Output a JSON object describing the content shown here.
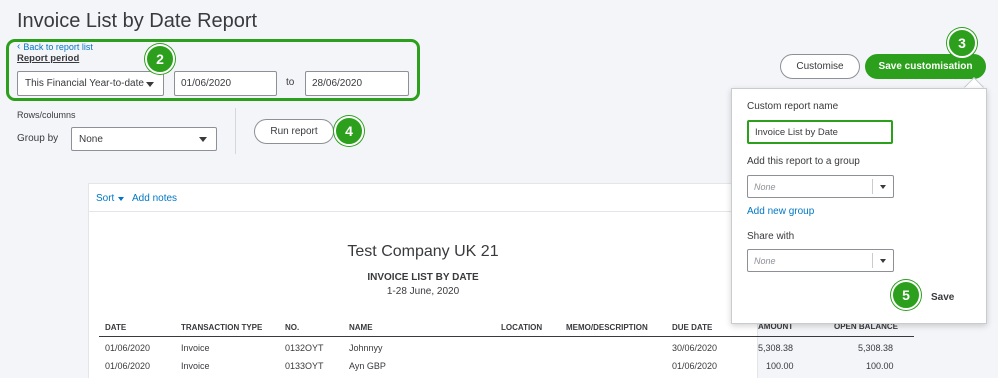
{
  "page": {
    "title": "Invoice List by Date Report",
    "back_link": "Back to report list",
    "report_period_label": "Report period"
  },
  "period": {
    "selected": "This Financial Year-to-date",
    "start_date": "01/06/2020",
    "to_label": "to",
    "end_date": "28/06/2020"
  },
  "rows_columns": {
    "section_label": "Rows/columns",
    "group_by_label": "Group by",
    "group_by_value": "None"
  },
  "buttons": {
    "run_report": "Run report",
    "customise": "Customise",
    "save_customisation": "Save customisation"
  },
  "badges": [
    "2",
    "3",
    "4",
    "5"
  ],
  "report": {
    "sort_label": "Sort",
    "add_notes": "Add notes",
    "company": "Test Company UK 21",
    "name": "INVOICE LIST BY DATE",
    "range": "1-28 June, 2020",
    "columns": [
      "DATE",
      "TRANSACTION TYPE",
      "NO.",
      "NAME",
      "LOCATION",
      "MEMO/DESCRIPTION",
      "DUE DATE",
      "AMOUNT",
      "OPEN BALANCE"
    ],
    "rows": [
      {
        "date": "01/06/2020",
        "type": "Invoice",
        "no": "0132OYT",
        "name": "Johnnyy",
        "location": "",
        "memo": "",
        "due": "30/06/2020",
        "amount": "5,308.38",
        "open": "5,308.38"
      },
      {
        "date": "01/06/2020",
        "type": "Invoice",
        "no": "0133OYT",
        "name": "Ayn GBP",
        "location": "",
        "memo": "",
        "due": "01/06/2020",
        "amount": "100.00",
        "open": "100.00"
      }
    ]
  },
  "popover": {
    "custom_name_label": "Custom report name",
    "custom_name_value": "Invoice List by Date",
    "group_label": "Add this report to a group",
    "group_value": "None",
    "add_new_group": "Add new group",
    "share_label": "Share with",
    "share_value": "None",
    "save": "Save"
  },
  "colors": {
    "green": "#2ca01c",
    "link": "#0077c5",
    "text": "#393a3d",
    "background": "#f4f5f8"
  }
}
